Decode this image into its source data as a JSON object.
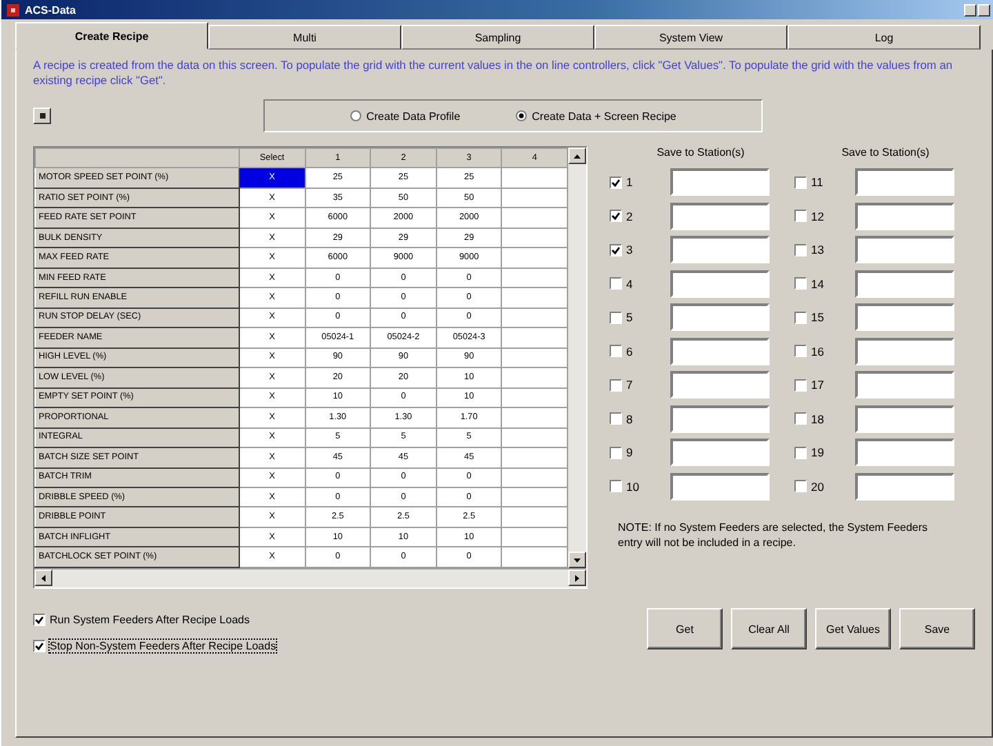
{
  "window": {
    "title": "ACS-Data"
  },
  "tabs": [
    {
      "label": "Create Recipe",
      "selected": true
    },
    {
      "label": "Multi",
      "selected": false
    },
    {
      "label": "Sampling",
      "selected": false
    },
    {
      "label": "System View",
      "selected": false
    },
    {
      "label": "Log",
      "selected": false
    }
  ],
  "description": "A recipe is created from the data on this screen. To populate the grid with the current values in the on line controllers, click \"Get Values\". To populate the grid with the values from an existing recipe click \"Get\".",
  "recipe_type": [
    {
      "label": "Create Data Profile",
      "selected": false
    },
    {
      "label": "Create Data + Screen Recipe",
      "selected": true
    }
  ],
  "grid": {
    "columns": [
      "Select",
      "1",
      "2",
      "3",
      "4"
    ],
    "rows": [
      {
        "label": "MOTOR SPEED SET POINT (%)",
        "select": "X",
        "select_highlighted": true,
        "values": [
          "25",
          "25",
          "25"
        ]
      },
      {
        "label": "RATIO SET POINT (%)",
        "select": "X",
        "select_highlighted": false,
        "values": [
          "35",
          "50",
          "50"
        ]
      },
      {
        "label": "FEED RATE SET POINT",
        "select": "X",
        "select_highlighted": false,
        "values": [
          "6000",
          "2000",
          "2000"
        ]
      },
      {
        "label": "BULK DENSITY",
        "select": "X",
        "select_highlighted": false,
        "values": [
          "29",
          "29",
          "29"
        ]
      },
      {
        "label": "MAX FEED RATE",
        "select": "X",
        "select_highlighted": false,
        "values": [
          "6000",
          "9000",
          "9000"
        ]
      },
      {
        "label": "MIN FEED RATE",
        "select": "X",
        "select_highlighted": false,
        "values": [
          "0",
          "0",
          "0"
        ]
      },
      {
        "label": "REFILL RUN ENABLE",
        "select": "X",
        "select_highlighted": false,
        "values": [
          "0",
          "0",
          "0"
        ]
      },
      {
        "label": "RUN STOP DELAY (SEC)",
        "select": "X",
        "select_highlighted": false,
        "values": [
          "0",
          "0",
          "0"
        ]
      },
      {
        "label": "FEEDER NAME",
        "select": "X",
        "select_highlighted": false,
        "values": [
          "05024-1",
          "05024-2",
          "05024-3"
        ]
      },
      {
        "label": "HIGH LEVEL (%)",
        "select": "X",
        "select_highlighted": false,
        "values": [
          "90",
          "90",
          "90"
        ]
      },
      {
        "label": "LOW LEVEL (%)",
        "select": "X",
        "select_highlighted": false,
        "values": [
          "20",
          "20",
          "10"
        ]
      },
      {
        "label": "EMPTY SET POINT (%)",
        "select": "X",
        "select_highlighted": false,
        "values": [
          "10",
          "0",
          "10"
        ]
      },
      {
        "label": "PROPORTIONAL",
        "select": "X",
        "select_highlighted": false,
        "values": [
          "1.30",
          "1.30",
          "1.70"
        ]
      },
      {
        "label": "INTEGRAL",
        "select": "X",
        "select_highlighted": false,
        "values": [
          "5",
          "5",
          "5"
        ]
      },
      {
        "label": "BATCH SIZE SET POINT",
        "select": "X",
        "select_highlighted": false,
        "values": [
          "45",
          "45",
          "45"
        ]
      },
      {
        "label": "BATCH TRIM",
        "select": "X",
        "select_highlighted": false,
        "values": [
          "0",
          "0",
          "0"
        ]
      },
      {
        "label": "DRIBBLE SPEED (%)",
        "select": "X",
        "select_highlighted": false,
        "values": [
          "0",
          "0",
          "0"
        ]
      },
      {
        "label": "DRIBBLE POINT",
        "select": "X",
        "select_highlighted": false,
        "values": [
          "2.5",
          "2.5",
          "2.5"
        ]
      },
      {
        "label": "BATCH INFLIGHT",
        "select": "X",
        "select_highlighted": false,
        "values": [
          "10",
          "10",
          "10"
        ]
      },
      {
        "label": "BATCHLOCK SET POINT (%)",
        "select": "X",
        "select_highlighted": false,
        "values": [
          "0",
          "0",
          "0"
        ]
      }
    ]
  },
  "station_groups": [
    {
      "heading": "Save to Station(s)",
      "stations": [
        {
          "label": "1",
          "checked": true
        },
        {
          "label": "2",
          "checked": true
        },
        {
          "label": "3",
          "checked": true
        },
        {
          "label": "4",
          "checked": false
        },
        {
          "label": "5",
          "checked": false
        },
        {
          "label": "6",
          "checked": false
        },
        {
          "label": "7",
          "checked": false
        },
        {
          "label": "8",
          "checked": false
        },
        {
          "label": "9",
          "checked": false
        },
        {
          "label": "10",
          "checked": false
        }
      ]
    },
    {
      "heading": "Save to Station(s)",
      "stations": [
        {
          "label": "11",
          "checked": false
        },
        {
          "label": "12",
          "checked": false
        },
        {
          "label": "13",
          "checked": false
        },
        {
          "label": "14",
          "checked": false
        },
        {
          "label": "15",
          "checked": false
        },
        {
          "label": "16",
          "checked": false
        },
        {
          "label": "17",
          "checked": false
        },
        {
          "label": "18",
          "checked": false
        },
        {
          "label": "19",
          "checked": false
        },
        {
          "label": "20",
          "checked": false
        }
      ]
    }
  ],
  "note": "NOTE: If no System Feeders are selected, the System Feeders entry will not be included in a recipe.",
  "options": [
    {
      "label": "Run System Feeders After Recipe Loads",
      "checked": true,
      "focused": false
    },
    {
      "label": "Stop Non-System Feeders After Recipe Loads",
      "checked": true,
      "focused": true
    }
  ],
  "buttons": [
    "Get",
    "Clear All",
    "Get Values",
    "Save"
  ]
}
